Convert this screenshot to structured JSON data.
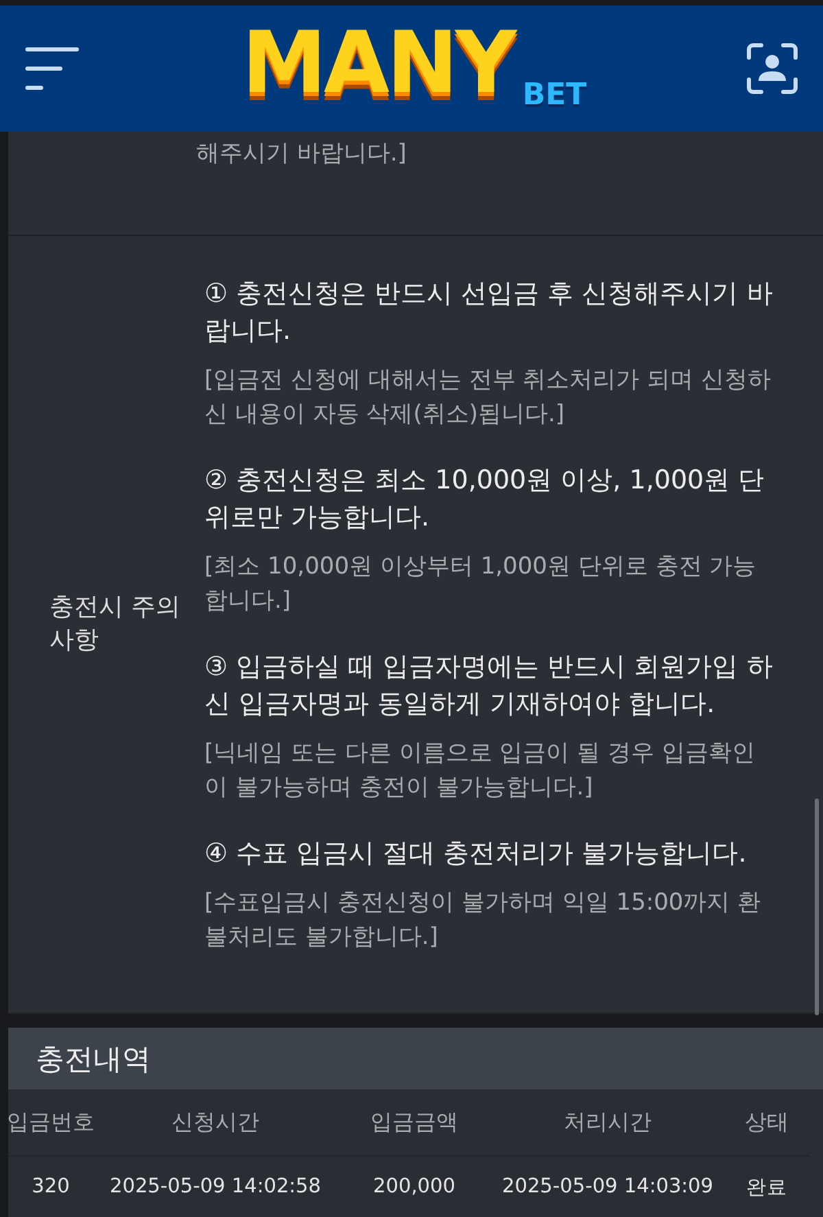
{
  "header": {
    "logo_main": "MANY",
    "logo_sub": "BET"
  },
  "previous_row": {
    "note": "해주시기 바랍니다.]"
  },
  "notice": {
    "label": "충전시 주의사항",
    "items": [
      {
        "title": "① 충전신청은 반드시 선입금 후 신청해주시기 바랍니다.",
        "note": "[입금전 신청에 대해서는 전부 취소처리가 되며 신청하신 내용이 자동 삭제(취소)됩니다.]"
      },
      {
        "title": "② 충전신청은 최소 10,000원 이상, 1,000원 단위로만 가능합니다.",
        "note": "[최소 10,000원 이상부터 1,000원 단위로 충전 가능합니다.]"
      },
      {
        "title": "③ 입금하실 때 입금자명에는 반드시 회원가입 하신 입금자명과 동일하게 기재하여야 합니다.",
        "note": "[닉네임 또는 다른 이름으로 입금이 될 경우 입금확인이 불가능하며 충전이 불가능합니다.]"
      },
      {
        "title": "④ 수표 입금시 절대 충전처리가 불가능합니다.",
        "note": "[수표입금시 충전신청이 불가하며 익일 15:00까지 환불처리도 불가합니다.]"
      }
    ]
  },
  "history": {
    "title": "충전내역",
    "columns": [
      "입금번호",
      "신청시간",
      "입금금액",
      "처리시간",
      "상태"
    ],
    "rows": [
      [
        "320",
        "2025-05-09 14:02:58",
        "200,000",
        "2025-05-09 14:03:09",
        "완료"
      ]
    ]
  }
}
